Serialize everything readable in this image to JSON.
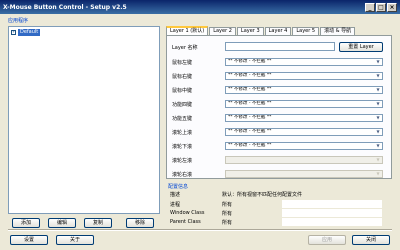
{
  "window": {
    "title": "X-Mouse Button Control - Setup v2.5"
  },
  "apps_group": {
    "label": "应用程序",
    "items": [
      {
        "label": "Default",
        "checked": true
      }
    ]
  },
  "list_buttons": {
    "add": "添加",
    "edit": "编辑",
    "copy": "复制",
    "remove": "移除"
  },
  "tabs": [
    {
      "label": "Layer 1 (默认)",
      "active": true
    },
    {
      "label": "Layer 2"
    },
    {
      "label": "Layer 3"
    },
    {
      "label": "Layer 4"
    },
    {
      "label": "Layer 5"
    },
    {
      "label": "滚动 & 导航"
    }
  ],
  "layer": {
    "name_label": "Layer 名称",
    "rename_button": "重置 Layer",
    "rows": [
      {
        "label": "鼠标左键",
        "value": "** 不修改 - 不拦截 **"
      },
      {
        "label": "鼠标右键",
        "value": "** 不修改 - 不拦截 **"
      },
      {
        "label": "鼠标中键",
        "value": "** 不修改 - 不拦截 **"
      },
      {
        "label": "功能四键",
        "value": "** 不修改 - 不拦截 **"
      },
      {
        "label": "功能五键",
        "value": "** 不修改 - 不拦截 **"
      },
      {
        "label": "滚轮上滚",
        "value": "** 不修改 - 不拦截 **"
      },
      {
        "label": "滚轮下滚",
        "value": "** 不修改 - 不拦截 **"
      },
      {
        "label": "滚轮左滚",
        "value": ""
      },
      {
        "label": "滚轮右滚",
        "value": ""
      }
    ]
  },
  "config": {
    "title": "配置信息",
    "rows": [
      {
        "label": "描述",
        "value": "默认：所有视窗不匹配任何配置文件"
      },
      {
        "label": "进程",
        "value": "所有"
      },
      {
        "label": "Window Class",
        "value": "所有"
      },
      {
        "label": "Parent Class",
        "value": "所有"
      }
    ]
  },
  "footer": {
    "settings": "设置",
    "about": "关于",
    "apply": "应用",
    "close": "关闭"
  }
}
